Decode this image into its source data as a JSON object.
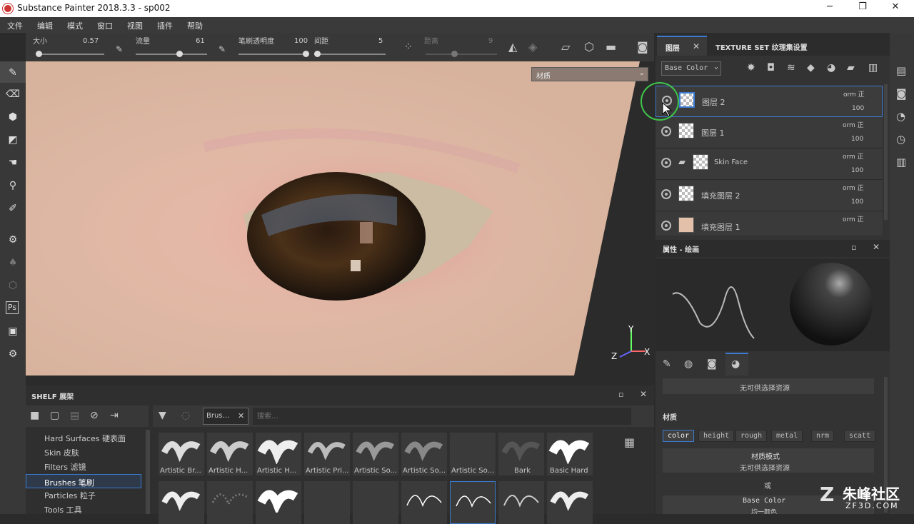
{
  "window": {
    "title": "Substance Painter 2018.3.3 - sp002",
    "min": "─",
    "max": "❐",
    "close": "✕"
  },
  "menu": [
    "文件",
    "编辑",
    "模式",
    "窗口",
    "视图",
    "插件",
    "帮助"
  ],
  "toolbar": {
    "size_label": "大小",
    "size_value": "0.57",
    "flow_label": "流量",
    "flow_value": "61",
    "opacity_label": "笔刷透明度",
    "opacity_value": "100",
    "spacing_label": "间距",
    "spacing_value": "5",
    "distance_label": "距离",
    "distance_value": "9"
  },
  "viewport": {
    "material_dropdown": "材质",
    "axis_y": "Y",
    "axis_z": "Z",
    "axis_x": "X"
  },
  "layers_panel": {
    "tab_layers": "图层",
    "tab_texture_set": "TEXTURE SET 纹理集设置",
    "channel_select": "Base Color",
    "layers": [
      {
        "name": "图层 2",
        "blend": "orm 正",
        "opacity": "100"
      },
      {
        "name": "图层 1",
        "blend": "orm 正",
        "opacity": "100"
      },
      {
        "name": "Skin Face",
        "blend": "orm 正",
        "opacity": "100"
      },
      {
        "name": "填充图层 2",
        "blend": "orm 正",
        "opacity": "100"
      },
      {
        "name": "填充图层 1",
        "blend": "orm 正",
        "opacity": ""
      }
    ]
  },
  "properties": {
    "title": "属性 - 绘画",
    "no_resource_1": "无可供选择资源",
    "material_header": "材质",
    "channels": [
      "color",
      "height",
      "rough",
      "metal",
      "nrm",
      "scatt"
    ],
    "material_mode_label": "材质模式",
    "no_resource_2": "无可供选择资源",
    "or_label": "或",
    "base_color_label": "Base Color",
    "base_color_value": "均一颜色"
  },
  "shelf": {
    "title": "SHELF 展架",
    "search_placeholder": "搜索...",
    "filter_tag": "Brus…",
    "categories": [
      "Hard Surfaces 硬表面",
      "Skin 皮肤",
      "Filters 滤镜",
      "Brushes 笔刷",
      "Particles 粒子",
      "Tools 工具"
    ],
    "selected_category": "Brushes 笔刷",
    "brushes": [
      "Artistic Br...",
      "Artistic H...",
      "Artistic H...",
      "Artistic Pri...",
      "Artistic So...",
      "Artistic So...",
      "Artistic So...",
      "Bark",
      "Basic Hard"
    ]
  },
  "watermark": {
    "name": "朱峰社区",
    "site": "ZF3D.COM"
  }
}
